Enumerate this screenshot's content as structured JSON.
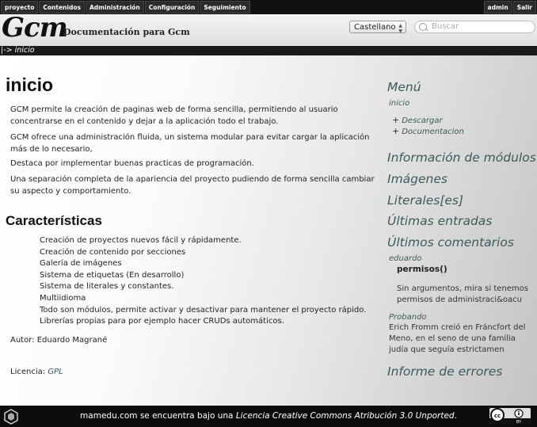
{
  "topbar": {
    "nav": [
      "proyecto",
      "Contenidos",
      "Administración",
      "Configuración",
      "Seguimiento"
    ],
    "right": [
      "admin",
      "Salir"
    ]
  },
  "header": {
    "logo": "Gcm",
    "tagline": "Documentación para Gcm",
    "language": "Castellano",
    "search_placeholder": "Buscar"
  },
  "breadcrumb": {
    "arrow": "|->",
    "current": "inicio"
  },
  "content": {
    "title": "inicio",
    "paragraphs": [
      "GCM permite la creación de paginas web de forma sencilla, permitiendo al usuario concentrarse en el contenido y dejar a la aplicación todo el trabajo.",
      "GCM ofrece una administración fluida, un sistema modular para evitar cargar la aplicación más de lo necesario,",
      "Destaca por implementar buenas practicas de programación.",
      "Una separación completa de la apariencia del proyecto pudiendo de forma sencilla cambiar su aspecto y comportamiento."
    ],
    "features_title": "Características",
    "features": [
      "Creación de proyectos nuevos fácil y rápidamente.",
      "Creación de contenido por secciones",
      "Galería de imágenes",
      "Sistema de etiquetas (En desarrollo)",
      "Sistema de literales y constantes.",
      "Multiidioma",
      "Todo son módulos, permite activar y desactivar para mantener el proyecto rápido.",
      "Librerías propias para por ejemplo hacer CRUDs automáticos."
    ],
    "author_label": "Autor:",
    "author": "Eduardo Magrané",
    "license_label": "Licencia:",
    "license": "GPL"
  },
  "sidebar": {
    "menu_title": "Menú",
    "menu_current": "inicio",
    "menu_items": [
      "Descargar",
      "Documentacion"
    ],
    "modules_title": "Información de módulos",
    "images_title": "Imágenes",
    "literals_title": "Literales[es]",
    "latest_title": "Últimas entradas",
    "comments_title": "Últimos comentarios",
    "comment1": {
      "author": "eduardo",
      "title": "permisos()",
      "text": "Sin argumentos, mira si tenemos permisos de administraci&oacu"
    },
    "comment2": {
      "author": "Probando",
      "text": "Erich Fromm creió en Fráncfort del Meno, en el seno de una familia judía que seguía estrictamen"
    },
    "errors_title": "Informe de errores"
  },
  "footer": {
    "text_before": "mamedu.com se encuentra bajo una ",
    "license_link": "Licencia Creative Commons Atribución 3.0 Unported",
    "text_after": ".",
    "cc_label": "BY"
  }
}
